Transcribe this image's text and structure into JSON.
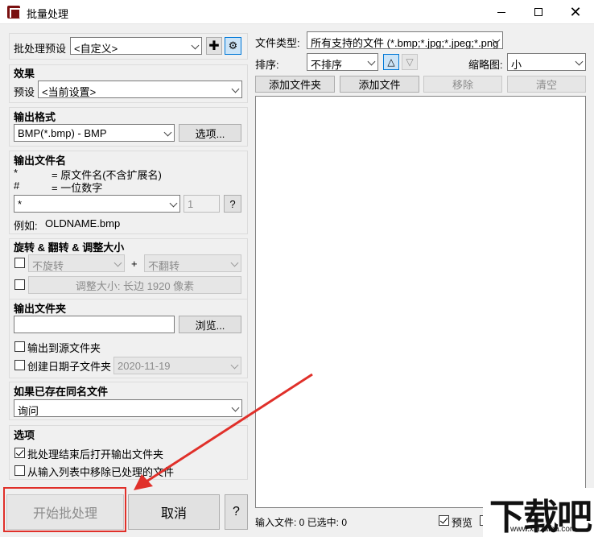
{
  "window": {
    "title": "批量处理",
    "minimize_icon": "minimize-icon",
    "maximize_icon": "maximize-icon",
    "close_icon": "close-icon"
  },
  "preset": {
    "label": "批处理预设",
    "value": "<自定义>"
  },
  "effects": {
    "title": "效果",
    "preset_label": "预设",
    "preset_value": "<当前设置>"
  },
  "output_format": {
    "title": "输出格式",
    "value": "BMP(*.bmp) - BMP",
    "options_button": "选项..."
  },
  "output_filename": {
    "title": "输出文件名",
    "legend_star": "*",
    "legend_star_desc": "= 原文件名(不含扩展名)",
    "legend_hash": "#",
    "legend_hash_desc": "= 一位数字",
    "pattern_value": "*",
    "digits_value": "1",
    "help_button": "?",
    "example_label": "例如:",
    "example_value": "OLDNAME.bmp"
  },
  "rotate_flip": {
    "title": "旋转 & 翻转 & 调整大小",
    "rotate_value": "不旋转",
    "plus": "+",
    "flip_value": "不翻转",
    "resize_button": "调整大小: 长边 1920 像素"
  },
  "output_folder": {
    "title": "输出文件夹",
    "path_value": "",
    "browse_button": "浏览...",
    "to_source_label": "输出到源文件夹",
    "date_subfolder_label": "创建日期子文件夹",
    "date_value": "2020-11-19"
  },
  "if_exists": {
    "title": "如果已存在同名文件",
    "value": "询问"
  },
  "options": {
    "title": "选项",
    "open_folder_label": "批处理结束后打开输出文件夹",
    "remove_processed_label": "从输入列表中移除已处理的文件"
  },
  "right_panel": {
    "file_type_label": "文件类型:",
    "file_type_value": "所有支持的文件 (*.bmp;*.jpg;*.jpeg;*.png",
    "sort_label": "排序:",
    "sort_value": "不排序",
    "sort_asc_glyph": "△",
    "sort_desc_glyph": "▽",
    "thumb_label": "缩略图:",
    "thumb_value": "小",
    "add_folder_button": "添加文件夹",
    "add_file_button": "添加文件",
    "remove_button": "移除",
    "clear_button": "清空",
    "status_text": "输入文件: 0 已选中: 0",
    "preview_label": "预览"
  },
  "footer": {
    "start_button": "开始批处理",
    "cancel_button": "取消",
    "help_button": "?"
  },
  "watermark": {
    "text": "下载吧",
    "url": "www.xiazaiba.com"
  },
  "colors": {
    "highlight": "#e0302a",
    "arrow": "#e0302a"
  }
}
